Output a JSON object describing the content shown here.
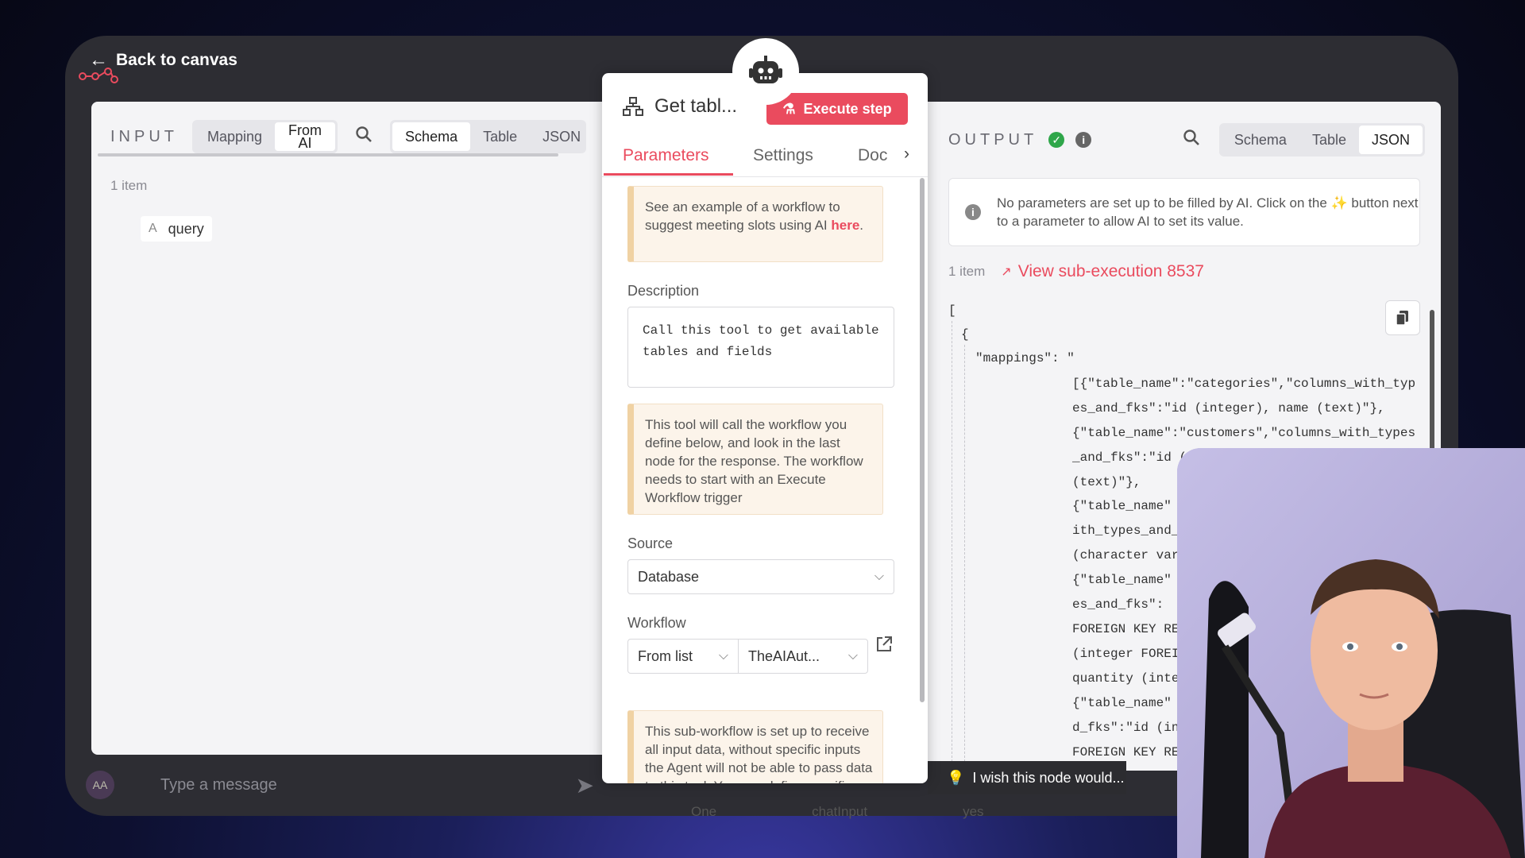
{
  "nav": {
    "back_label": "Back to canvas"
  },
  "input": {
    "title": "INPUT",
    "mode_tabs": [
      "Mapping",
      "From AI"
    ],
    "view_tabs": [
      "Schema",
      "Table",
      "JSON"
    ],
    "item_count": "1 item",
    "field": {
      "type": "A",
      "name": "query"
    }
  },
  "chat": {
    "avatar": "AA",
    "placeholder": "Type a message"
  },
  "node": {
    "title": "Get tabl...",
    "execute_label": "Execute step",
    "tabs": [
      "Parameters",
      "Settings",
      "Doc"
    ],
    "example_callout": {
      "text": "See an example of a workflow to suggest meeting slots using AI ",
      "link": "here",
      "end": "."
    },
    "description_label": "Description",
    "description_value": "Call this tool to get available tables and fields",
    "tool_callout": "This tool will call the workflow you define below, and look in the last node for the response. The workflow needs to start with an Execute Workflow trigger",
    "source_label": "Source",
    "source_value": "Database",
    "workflow_label": "Workflow",
    "workflow_mode": "From list",
    "workflow_value": "TheAIAut...",
    "subworkflow_callout": "This sub-workflow is set up to receive all input data, without specific inputs the Agent will not be able to pass data to this tool. You can define specific inputs in"
  },
  "output": {
    "title": "OUTPUT",
    "view_tabs": [
      "Schema",
      "Table",
      "JSON"
    ],
    "notice": "No parameters are set up to be filled by AI. Click on the ✨ button next to a parameter to allow AI to set its value.",
    "item_count": "1 item",
    "subexecution_link": "View sub-execution 8537",
    "json_lines": [
      "[",
      "{",
      "\"mappings\":  \"",
      "[{\"table_name\":\"categories\",\"columns_with_typ",
      "es_and_fks\":\"id (integer), name (text)\"},",
      "{\"table_name\":\"customers\",\"columns_with_types",
      "_and_fks\":\"id (in",
      "(text)\"},",
      "{\"table_name\"",
      "ith_types_and_",
      "(character var",
      "{\"table_name\"",
      "es_and_fks\":",
      "FOREIGN KEY RE",
      "(integer FOREI",
      "quantity (inte",
      "{\"table_name\"",
      "d_fks\":\"id (in",
      "FOREIGN KEY RE"
    ]
  },
  "feedback": {
    "text": "I wish this node would..."
  },
  "bottom_row": {
    "col1": "One",
    "col2": "chatInput",
    "col3": "yes"
  },
  "colors": {
    "accent": "#ea4b5e",
    "success": "#2fa64a",
    "callout_bg": "#fcf4ea"
  }
}
